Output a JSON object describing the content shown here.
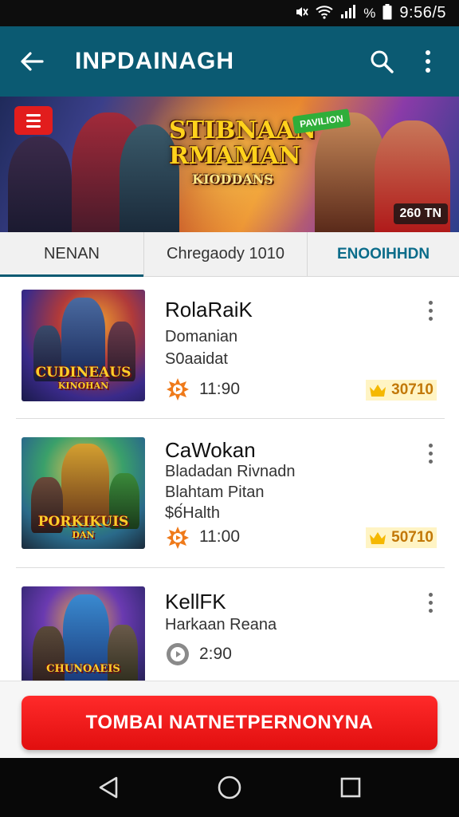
{
  "status_bar": {
    "time": "9:56/5",
    "icons": [
      "mute-icon",
      "wifi-icon",
      "signal-icon",
      "battery-icon"
    ],
    "signal_text": "%"
  },
  "app_bar": {
    "title": "INPDAINAGH",
    "back_icon": "arrow-left-icon",
    "search_icon": "search-icon",
    "more_icon": "more-vert-icon"
  },
  "banner": {
    "title_line1": "STIBNAAN",
    "title_line2": "RMAMAN",
    "title_line3": "KIODDANS",
    "green_tag": "PAVILION",
    "corner_tag": "260 TN"
  },
  "tabs": [
    {
      "label": "NENAN",
      "selected": true
    },
    {
      "label": "Chregaody 1010",
      "selected": false
    },
    {
      "label": "ENOOIHHDN",
      "selected": false
    }
  ],
  "items": [
    {
      "name": "RolaRaiK",
      "sub1": "Domanian",
      "sub2": "S0aaidat",
      "time": "11:90",
      "score": "30710",
      "thumb_label": "CUDINEAUS",
      "thumb_sub": "KINOHAN"
    },
    {
      "name": "CaWokan",
      "sub1": "Bladadan Rivnadn",
      "sub2": "Blahtam Pitan",
      "sub3": "$6́Halth",
      "time": "11:00",
      "score": "50710",
      "thumb_label": "PORKIKUIS",
      "thumb_sub": "DAN"
    },
    {
      "name": "KellFK",
      "sub1": "Harkaan Reana",
      "time": "2:90",
      "thumb_label": "CHUNOAEIS"
    }
  ],
  "cta": {
    "label": "TOMBAI NATNETPERNONYNA"
  },
  "colors": {
    "app_bar": "#0b5a72",
    "cta": "#e81414",
    "accent": "#0b6c8a"
  }
}
